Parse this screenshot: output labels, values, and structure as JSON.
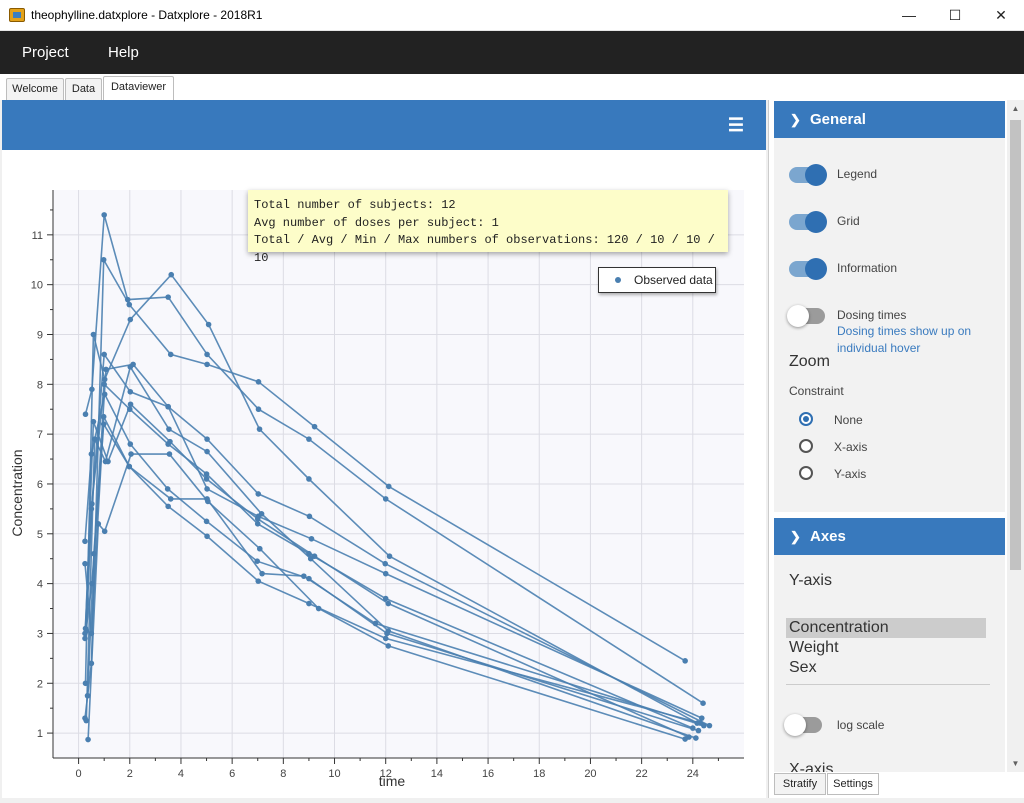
{
  "window": {
    "title": "theophylline.datxplore - Datxplore - 2018R1",
    "minimize": "—",
    "maximize": "☐",
    "close": "✕"
  },
  "menu": [
    "Project",
    "Help"
  ],
  "tabs": [
    "Welcome",
    "Data",
    "Dataviewer"
  ],
  "active_tab": "Dataviewer",
  "header": {
    "menu_icon": "☰"
  },
  "info_box": {
    "line1": "Total number of subjects: 12",
    "line2": "Avg number of doses per subject: 1",
    "line3": "Total / Avg / Min / Max numbers of observations: 120 / 10 / 10 / 10"
  },
  "legend": {
    "label": "Observed data"
  },
  "colors": {
    "accent": "#3879bd",
    "series": "#4a7fb0",
    "plot_bg": "#f8f8fc",
    "grid": "#dcdce4"
  },
  "settings": {
    "general": {
      "title": "General",
      "legend_label": "Legend",
      "legend_on": true,
      "grid_label": "Grid",
      "grid_on": true,
      "information_label": "Information",
      "information_on": true,
      "dosing_label": "Dosing times",
      "dosing_on": false,
      "dosing_note_1": "Dosing times show up on",
      "dosing_note_2": "individual hover",
      "zoom_title": "Zoom",
      "constraint_label": "Constraint",
      "constraint_options": [
        "None",
        "X-axis",
        "Y-axis"
      ],
      "constraint_selected": "None"
    },
    "axes": {
      "title": "Axes",
      "y_axis_title": "Y-axis",
      "y_options": [
        "Concentration",
        "Weight",
        "Sex"
      ],
      "y_selected": "Concentration",
      "log_scale_label": "log scale",
      "log_scale_on": false,
      "x_axis_title": "X-axis"
    }
  },
  "bottom_tabs": [
    "Stratify",
    "Settings"
  ],
  "chart_data": {
    "type": "line",
    "xlabel": "time",
    "ylabel": "Concentration",
    "xlim": [
      -1,
      26
    ],
    "ylim": [
      0.5,
      11.9
    ],
    "xticks": [
      0,
      2,
      4,
      6,
      8,
      10,
      12,
      14,
      16,
      18,
      20,
      22,
      24
    ],
    "yticks": [
      1,
      2,
      3,
      4,
      5,
      6,
      7,
      8,
      9,
      10,
      11
    ],
    "grid": true,
    "legend_position": "top-right",
    "series": [
      {
        "x": [
          0.27,
          0.52,
          1.0,
          1.92,
          3.5,
          5.02,
          7.03,
          9.0,
          12.0,
          24.4
        ],
        "values": [
          7.4,
          7.9,
          11.4,
          9.7,
          9.75,
          8.6,
          7.5,
          6.9,
          5.7,
          1.6
        ]
      },
      {
        "x": [
          0.25,
          0.5,
          0.98,
          1.98,
          3.6,
          5.02,
          7.03,
          9.22,
          12.12,
          23.7
        ],
        "values": [
          1.3,
          2.4,
          10.5,
          9.6,
          8.6,
          8.4,
          8.05,
          7.15,
          5.95,
          2.45
        ]
      },
      {
        "x": [
          0.27,
          0.58,
          1.02,
          2.02,
          3.62,
          5.08,
          7.07,
          9.0,
          12.15,
          24.17
        ],
        "values": [
          2.0,
          9.0,
          8.1,
          9.3,
          10.2,
          9.2,
          7.1,
          6.1,
          4.55,
          1.2
        ]
      },
      {
        "x": [
          0.35,
          0.6,
          1.07,
          2.13,
          3.5,
          5.02,
          7.02,
          9.02,
          11.98,
          24.65
        ],
        "values": [
          1.75,
          4.6,
          8.3,
          8.4,
          7.55,
          6.9,
          5.8,
          5.35,
          4.4,
          1.15
        ]
      },
      {
        "x": [
          0.3,
          0.52,
          1.0,
          2.02,
          3.5,
          5.02,
          7.02,
          9.1,
          12.0,
          24.35
        ],
        "values": [
          3.05,
          5.6,
          8.6,
          7.85,
          7.55,
          5.9,
          5.35,
          4.9,
          4.2,
          1.3
        ]
      },
      {
        "x": [
          0.27,
          0.58,
          1.15,
          2.03,
          3.57,
          5.0,
          7.0,
          9.22,
          12.1,
          23.85
        ],
        "values": [
          3.1,
          7.25,
          6.45,
          7.6,
          6.85,
          6.1,
          5.3,
          4.55,
          3.6,
          0.92
        ]
      },
      {
        "x": [
          0.25,
          0.5,
          1.02,
          2.02,
          3.48,
          5.0,
          6.98,
          9.0,
          12.05,
          24.22
        ],
        "values": [
          4.85,
          6.6,
          7.8,
          6.8,
          5.9,
          5.25,
          4.45,
          4.1,
          3.0,
          1.05
        ]
      },
      {
        "x": [
          0.25,
          0.52,
          0.98,
          1.98,
          3.6,
          5.02,
          7.17,
          8.8,
          11.6,
          24.43
        ],
        "values": [
          2.9,
          4.0,
          7.2,
          6.35,
          5.7,
          5.7,
          4.2,
          4.15,
          3.2,
          1.15
        ]
      },
      {
        "x": [
          0.3,
          0.63,
          1.05,
          2.02,
          3.53,
          5.02,
          7.15,
          9.07,
          12.1,
          24.12
        ],
        "values": [
          1.25,
          6.9,
          6.45,
          8.35,
          7.1,
          6.65,
          5.4,
          4.5,
          3.05,
          0.9
        ]
      },
      {
        "x": [
          0.37,
          0.77,
          1.02,
          2.05,
          3.55,
          5.05,
          7.08,
          9.38,
          12.1,
          23.7
        ],
        "values": [
          0.87,
          5.2,
          5.05,
          6.6,
          6.6,
          5.65,
          4.7,
          3.5,
          2.75,
          0.88
        ]
      },
      {
        "x": [
          0.25,
          0.5,
          0.98,
          1.98,
          3.5,
          5.02,
          7.02,
          9.0,
          12.0,
          24.3
        ],
        "values": [
          4.4,
          3.0,
          7.35,
          6.35,
          5.55,
          4.95,
          4.05,
          3.6,
          2.9,
          1.2
        ]
      },
      {
        "x": [
          0.25,
          0.5,
          1.0,
          2.0,
          3.5,
          5.0,
          7.0,
          9.0,
          12.0,
          24.0
        ],
        "values": [
          3.0,
          5.5,
          8.0,
          7.5,
          6.8,
          6.2,
          5.2,
          4.6,
          3.7,
          1.1
        ]
      }
    ]
  }
}
